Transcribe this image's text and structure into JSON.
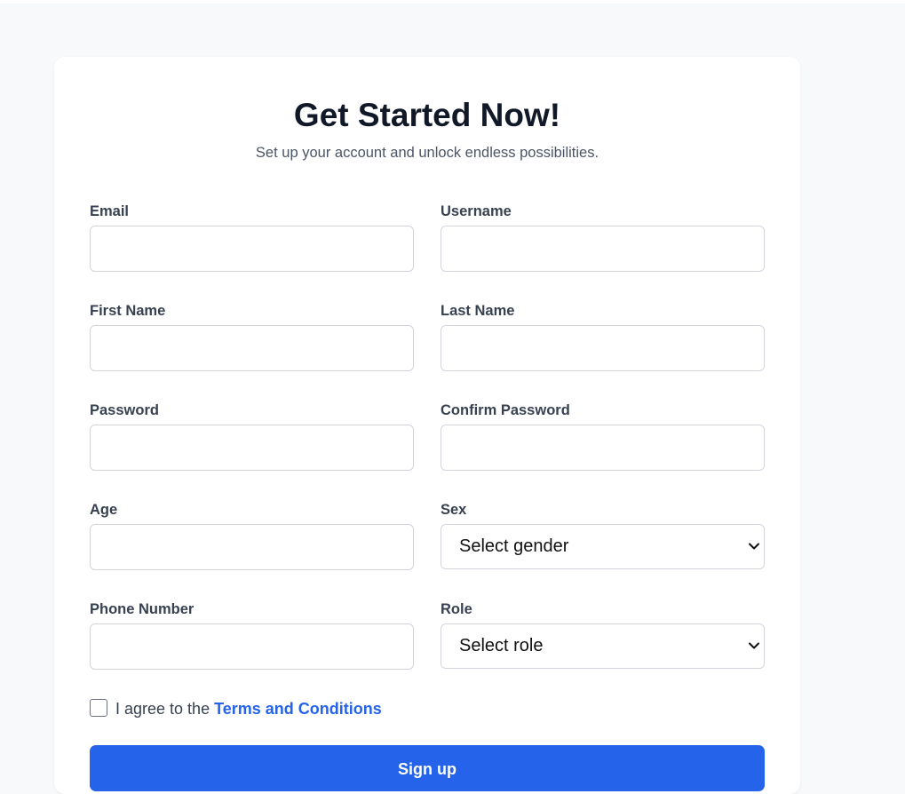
{
  "form": {
    "title": "Get Started Now!",
    "subtitle": "Set up your account and unlock endless possibilities.",
    "fields": {
      "email": {
        "label": "Email",
        "value": ""
      },
      "username": {
        "label": "Username",
        "value": ""
      },
      "first_name": {
        "label": "First Name",
        "value": ""
      },
      "last_name": {
        "label": "Last Name",
        "value": ""
      },
      "password": {
        "label": "Password",
        "value": ""
      },
      "confirm_password": {
        "label": "Confirm Password",
        "value": ""
      },
      "age": {
        "label": "Age",
        "value": ""
      },
      "sex": {
        "label": "Sex",
        "selected": "Select gender"
      },
      "phone": {
        "label": "Phone Number",
        "value": ""
      },
      "role": {
        "label": "Role",
        "selected": "Select role"
      }
    },
    "terms": {
      "checked": false,
      "prefix": "I agree to the ",
      "link_text": "Terms and Conditions"
    },
    "submit_label": "Sign up"
  },
  "colors": {
    "page_background": "#f8f9fb",
    "card_background": "#ffffff",
    "accent": "#2563eb",
    "heading": "#111827",
    "label": "#374151",
    "border": "#d1d5db"
  },
  "icons": {
    "select_indicator": "chevron-down-icon"
  }
}
